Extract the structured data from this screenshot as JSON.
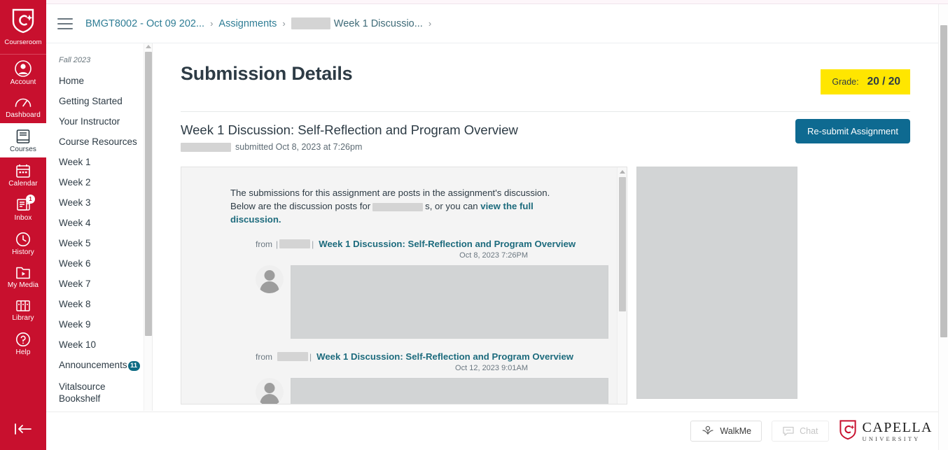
{
  "global_nav": {
    "logo": {
      "icon": "capella-shield-icon",
      "label": "Courseroom"
    },
    "items": [
      {
        "label": "Account",
        "icon": "account-avatar-icon",
        "active": false,
        "badge": ""
      },
      {
        "label": "Dashboard",
        "icon": "dashboard-gauge-icon",
        "active": false,
        "badge": ""
      },
      {
        "label": "Courses",
        "icon": "courses-book-icon",
        "active": true,
        "badge": ""
      },
      {
        "label": "Calendar",
        "icon": "calendar-icon",
        "active": false,
        "badge": ""
      },
      {
        "label": "Inbox",
        "icon": "inbox-envelope-icon",
        "active": false,
        "badge": "1"
      },
      {
        "label": "History",
        "icon": "history-clock-icon",
        "active": false,
        "badge": ""
      },
      {
        "label": "My Media",
        "icon": "my-media-video-icon",
        "active": false,
        "badge": ""
      },
      {
        "label": "Library",
        "icon": "library-books-icon",
        "active": false,
        "badge": ""
      },
      {
        "label": "Help",
        "icon": "help-question-icon",
        "active": false,
        "badge": ""
      }
    ],
    "collapse": {
      "icon": "collapse-arrow-left-icon",
      "label": ""
    }
  },
  "header": {
    "menu_icon": "hamburger-menu-icon",
    "breadcrumbs": [
      {
        "label": "BMGT8002 - Oct 09 202...",
        "redacted": false
      },
      {
        "label": "Assignments",
        "redacted": false
      },
      {
        "label": "Week 1 Discussio...",
        "redacted": true
      }
    ],
    "separator": "›"
  },
  "course_nav": {
    "term": "Fall 2023",
    "items": [
      {
        "label": "Home",
        "badge": ""
      },
      {
        "label": "Getting Started",
        "badge": ""
      },
      {
        "label": "Your Instructor",
        "badge": ""
      },
      {
        "label": "Course Resources",
        "badge": ""
      },
      {
        "label": "Week 1",
        "badge": ""
      },
      {
        "label": "Week 2",
        "badge": ""
      },
      {
        "label": "Week 3",
        "badge": ""
      },
      {
        "label": "Week 4",
        "badge": ""
      },
      {
        "label": "Week 5",
        "badge": ""
      },
      {
        "label": "Week 6",
        "badge": ""
      },
      {
        "label": "Week 7",
        "badge": ""
      },
      {
        "label": "Week 8",
        "badge": ""
      },
      {
        "label": "Week 9",
        "badge": ""
      },
      {
        "label": "Week 10",
        "badge": ""
      },
      {
        "label": "Announcements",
        "badge": "11"
      },
      {
        "label": "Vitalsource Bookshelf",
        "badge": ""
      }
    ]
  },
  "main": {
    "page_title": "Submission Details",
    "grade": {
      "label": "Grade:",
      "value": "20 / 20",
      "highlight_color": "#ffe600"
    },
    "assignment": {
      "title": "Week 1 Discussion: Self-Reflection and Program Overview",
      "submitted_text": "submitted Oct 8, 2023 at 7:26pm",
      "student_name_redacted": true
    },
    "resubmit_button": {
      "label": "Re-submit Assignment",
      "color": "#0e6a91"
    },
    "discussion": {
      "intro_part1": "The submissions for this assignment are posts in the assignment's discussion. Below are the discussion posts for",
      "intro_part2": "s, or you can",
      "intro_link": "view the full discussion.",
      "posts": [
        {
          "from_label": "from",
          "author_redacted": true,
          "title": "Week 1 Discussion: Self-Reflection and Program Overview",
          "date": "Oct 8, 2023 7:26PM",
          "body_redacted": true
        },
        {
          "from_label": "from",
          "author_redacted": true,
          "title": "Week 1 Discussion: Self-Reflection and Program Overview",
          "date": "Oct 12, 2023 9:01AM",
          "body_redacted": true
        }
      ]
    }
  },
  "footer": {
    "walkme_button": {
      "label": "WalkMe",
      "icon": "walkme-icon"
    },
    "chat_button": {
      "label": "Chat",
      "icon": "chat-bubble-icon",
      "disabled": true
    },
    "logo": {
      "name": "CAPELLA",
      "sub": "UNIVERSITY",
      "icon": "capella-shield-icon"
    }
  }
}
